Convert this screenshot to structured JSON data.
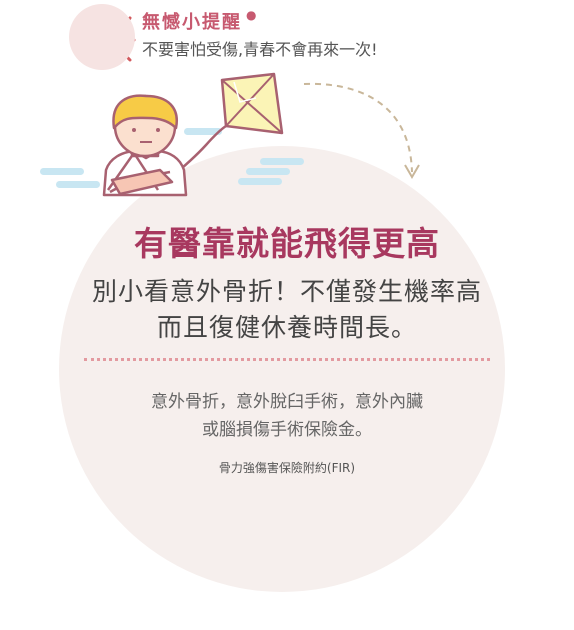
{
  "banner": {
    "title": "無憾小提醒",
    "subtitle": "不要害怕受傷,青春不會再來一次!"
  },
  "headline": "有醫靠就能飛得更高",
  "subheadline": {
    "line1": "別小看意外骨折！不僅發生機率高",
    "line2": "而且復健休養時間長。"
  },
  "details": {
    "line1": "意外骨折，意外脫臼手術，意外內臟",
    "line2": "或腦損傷手術保險金。"
  },
  "footnote": "骨力強傷害保險附約(FIR)",
  "colors": {
    "accent": "#a8385f",
    "banner_accent": "#c75a70",
    "circle_bg": "#f6efed",
    "cloud": "#c8e6f2",
    "kite": "#fbf4b6",
    "dots": "#e39aa0"
  },
  "icons": [
    "megaphone-icon",
    "boy-with-arm-sling-illustration",
    "kite-illustration",
    "cloud-icon",
    "dashed-arrow-icon"
  ]
}
